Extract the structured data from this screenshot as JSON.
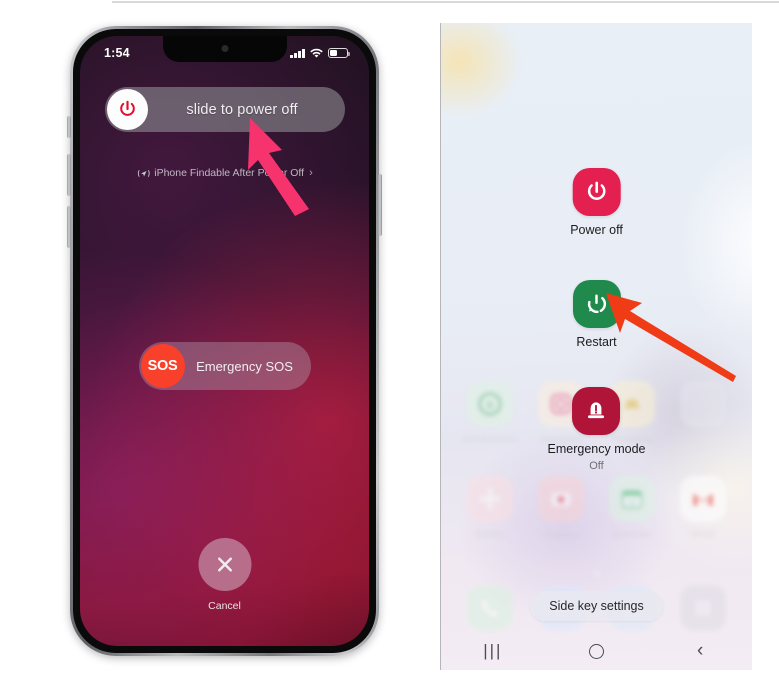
{
  "iphone": {
    "status": {
      "time": "1:54",
      "signal_icon": "cellular-bars-icon",
      "wifi_icon": "wifi-icon",
      "battery_icon": "battery-icon"
    },
    "power_slider": {
      "label": "slide to power off",
      "knob_icon": "power-icon"
    },
    "findable": {
      "icon": "findable-location-icon",
      "text": "iPhone Findable After Power Off",
      "chevron": "›"
    },
    "sos_slider": {
      "knob_label": "SOS",
      "label": "Emergency SOS"
    },
    "cancel": {
      "icon": "close-x-icon",
      "label": "Cancel"
    },
    "arrow": {
      "name": "pink-pointer-arrow",
      "color": "#f7336e"
    }
  },
  "samsung": {
    "items": [
      {
        "label": "Power off",
        "sub": "",
        "icon": "power-icon",
        "color": "#e3204f"
      },
      {
        "label": "Restart",
        "sub": "",
        "icon": "restart-icon",
        "color": "#1f8a4c"
      },
      {
        "label": "Emergency mode",
        "sub": "Off",
        "icon": "emergency-siren-icon",
        "color": "#b01438"
      }
    ],
    "side_key_settings": "Side key settings",
    "navbar": {
      "recents": "|||",
      "home": "home-circle-icon",
      "back": "‹"
    },
    "background_apps": {
      "row1": [
        {
          "label": "WA Business",
          "icon": "whatsapp-business-icon",
          "color": "#2ea84f"
        },
        {
          "label": "Instagram",
          "icon": "instagram-icon",
          "color": "#e6457a"
        },
        {
          "label": "Terrashow",
          "icon": "terrashow-icon",
          "color": "#e8c24a"
        },
        {
          "label": "",
          "icon": "app-icon",
          "color": "#cfcfd6"
        }
      ],
      "row2": [
        {
          "label": "Gallery",
          "icon": "gallery-icon",
          "color": "#f05a7e"
        },
        {
          "label": "Camera",
          "icon": "camera-icon",
          "color": "#ef5b6b"
        },
        {
          "label": "Calendar",
          "icon": "calendar-icon",
          "color": "#3dc06c"
        },
        {
          "label": "Gmail",
          "icon": "gmail-icon",
          "color": "#e84436"
        }
      ],
      "dock": [
        {
          "label": "",
          "icon": "phone-icon",
          "color": "#3dc06c"
        },
        {
          "label": "",
          "icon": "messages-icon",
          "color": "#6fa8f5"
        },
        {
          "label": "",
          "icon": "contacts-icon",
          "color": "#5ab0f0"
        },
        {
          "label": "",
          "icon": "app-drawer-icon",
          "color": "#cdc9d4"
        }
      ]
    },
    "arrow": {
      "name": "red-pointer-arrow",
      "color": "#ef3b16"
    }
  }
}
